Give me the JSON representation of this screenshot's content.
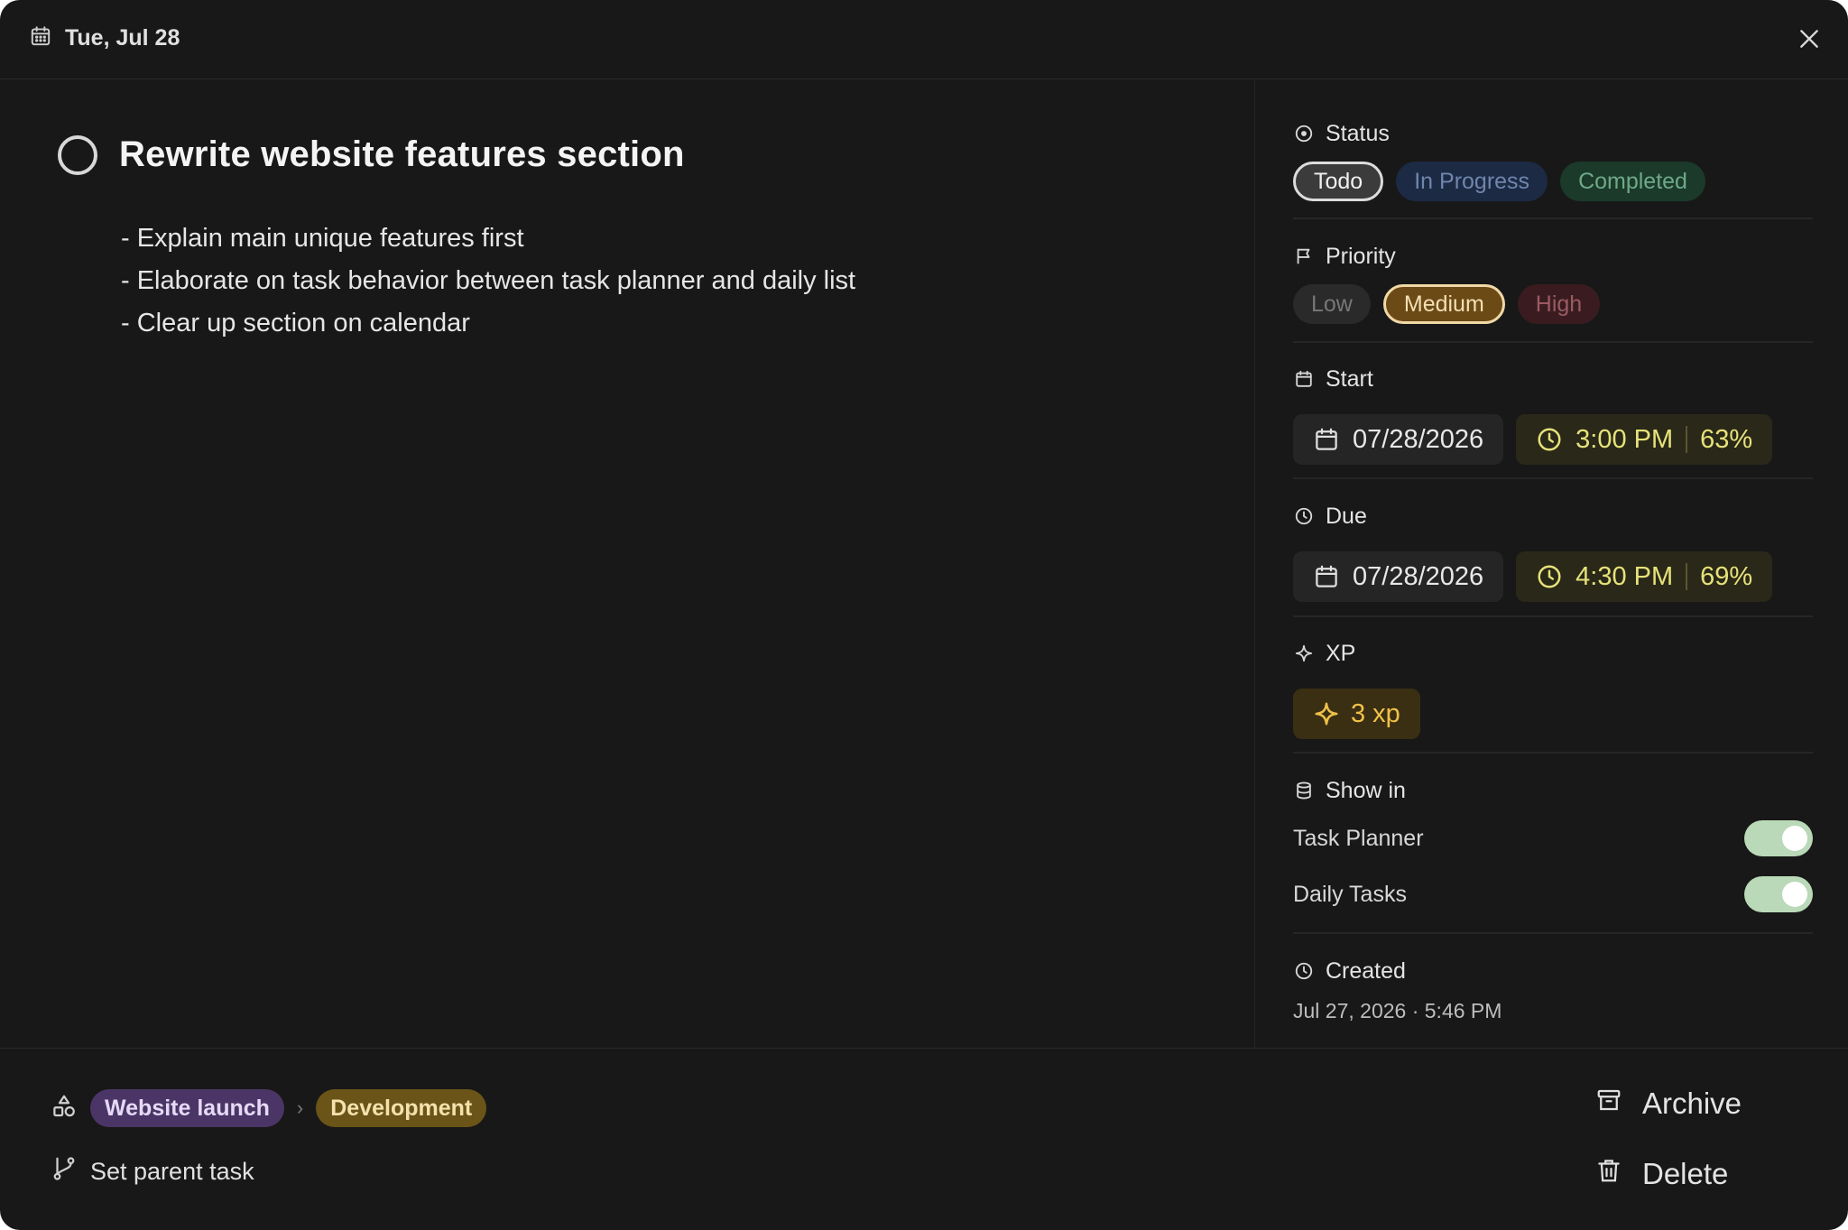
{
  "header": {
    "date": "Tue, Jul 28",
    "icons": [
      "calendar-icon",
      "close-icon"
    ]
  },
  "task": {
    "title": "Rewrite website features section",
    "description": [
      "- Explain main unique features first",
      "- Elaborate on task behavior between task planner and daily list",
      "- Clear up section on calendar"
    ]
  },
  "sidebar": {
    "status": {
      "label": "Status",
      "options": [
        "Todo",
        "In Progress",
        "Completed"
      ],
      "selected": "Todo"
    },
    "priority": {
      "label": "Priority",
      "options": [
        "Low",
        "Medium",
        "High"
      ],
      "selected": "Medium"
    },
    "start": {
      "label": "Start",
      "date": "07/28/2026",
      "time": "3:00 PM",
      "percent": "63%"
    },
    "due": {
      "label": "Due",
      "date": "07/28/2026",
      "time": "4:30 PM",
      "percent": "69%"
    },
    "xp": {
      "label": "XP",
      "value": "3 xp"
    },
    "show_in": {
      "label": "Show in",
      "items": [
        {
          "label": "Task Planner",
          "enabled": true
        },
        {
          "label": "Daily Tasks",
          "enabled": true
        }
      ]
    },
    "created": {
      "label": "Created",
      "value": "Jul 27, 2026 · 5:46 PM"
    }
  },
  "footer": {
    "project": "Website launch",
    "section": "Development",
    "parent_label": "Set parent task",
    "archive_label": "Archive",
    "delete_label": "Delete"
  },
  "colors": {
    "background": "#181818",
    "todo_border": "#dcdcdc",
    "in_progress": "#1c2a44",
    "completed": "#1b3a2a",
    "medium": "#6b4a16",
    "high": "#3a1c20",
    "time_text": "#e6e27a",
    "xp_text": "#f0c14a",
    "toggle_on": "#b9d9b8",
    "tag_purple": "#4b3567",
    "tag_gold": "#6b5417"
  }
}
